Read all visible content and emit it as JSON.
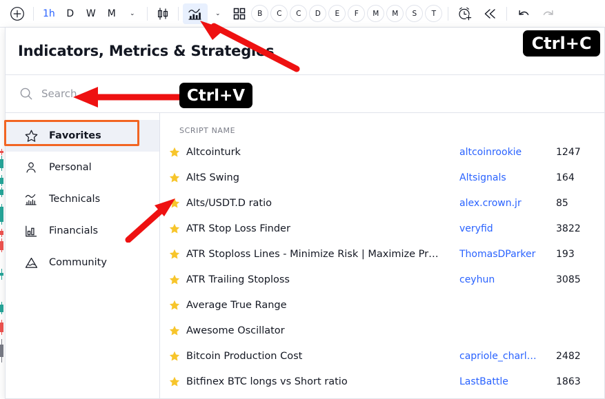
{
  "toolbar": {
    "add_label": "+",
    "timeframes": [
      {
        "label": "1h",
        "active": true
      },
      {
        "label": "D",
        "active": false
      },
      {
        "label": "W",
        "active": false
      },
      {
        "label": "M",
        "active": false
      }
    ],
    "timeframe_more": "⌄",
    "chart_style_icon": "candlestick-icon",
    "chart_type_icon": "indicators-chart-icon",
    "chart_type_more": "⌄",
    "layout_icon": "grid-layout-icon",
    "badges": [
      "B",
      "C",
      "C",
      "D",
      "E",
      "F",
      "M",
      "M",
      "S",
      "T"
    ],
    "alert_icon": "alarm-clock-add-icon",
    "replay_icon": "replay-rewind-icon",
    "undo_icon": "undo-arrow-icon",
    "redo_icon": "redo-arrow-icon"
  },
  "dialog": {
    "title": "Indicators, Metrics & Strategies",
    "search": {
      "placeholder": "Search",
      "value": "",
      "icon": "search-icon"
    },
    "sidebar": [
      {
        "label": "Favorites",
        "icon": "star-outline-icon",
        "selected": true
      },
      {
        "label": "Personal",
        "icon": "person-icon",
        "selected": false
      },
      {
        "label": "Technicals",
        "icon": "technicals-chart-icon",
        "selected": false
      },
      {
        "label": "Financials",
        "icon": "bar-chart-icon",
        "selected": false
      },
      {
        "label": "Community",
        "icon": "community-mountain-icon",
        "selected": false
      }
    ],
    "list": {
      "column_header": "SCRIPT NAME",
      "rows": [
        {
          "name": "Altcointurk",
          "author": "altcoinrookie",
          "likes": "1247"
        },
        {
          "name": "AltS Swing",
          "author": "Altsignals",
          "likes": "164"
        },
        {
          "name": "Alts/USDT.D ratio",
          "author": "alex.crown.jr",
          "likes": "85"
        },
        {
          "name": "ATR Stop Loss Finder",
          "author": "veryfid",
          "likes": "3822"
        },
        {
          "name": "ATR Stoploss Lines - Minimize Risk | Maximize Pr…",
          "author": "ThomasDParker",
          "likes": "193"
        },
        {
          "name": "ATR Trailing Stoploss",
          "author": "ceyhun",
          "likes": "3085"
        },
        {
          "name": "Average True Range",
          "author": "",
          "likes": ""
        },
        {
          "name": "Awesome Oscillator",
          "author": "",
          "likes": ""
        },
        {
          "name": "Bitcoin Production Cost",
          "author": "capriole_charl…",
          "likes": "2482"
        },
        {
          "name": "Bitfinex BTC longs vs Short ratio",
          "author": "LastBattle",
          "likes": "1863"
        }
      ]
    }
  },
  "annotations": {
    "badge_copy": "Ctrl+C",
    "badge_paste": "Ctrl+V",
    "arrow_to_chart_type": "red-arrow-icon",
    "arrow_to_search": "red-arrow-icon",
    "arrow_to_favorites_star": "red-arrow-icon"
  },
  "colors": {
    "accent_blue": "#2962ff",
    "star_yellow": "#f7c52b",
    "highlight_orange": "#f26522",
    "annotation_black": "#000000",
    "text_primary": "#131722",
    "text_muted": "#787b86",
    "border": "#e0e3eb",
    "selected_row_bg": "#eef1f7"
  },
  "chart_background": {
    "type": "candlestick",
    "up_color": "#26a69a",
    "down_color": "#ef5350",
    "visible_fragment": "left-edge-sliver"
  }
}
